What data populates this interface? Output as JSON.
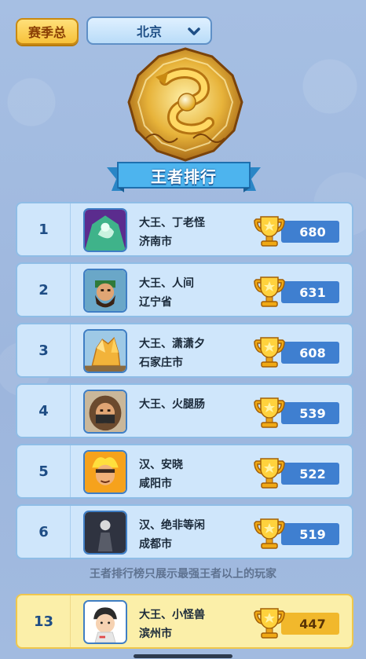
{
  "header": {
    "season_label": "赛季总",
    "city_selected": "北京"
  },
  "banner": {
    "title": "王者排行"
  },
  "ranking": [
    {
      "rank": "1",
      "name": "大王、丁老怪",
      "city": "济南市",
      "score": "680",
      "avatar": "jade-warrior"
    },
    {
      "rank": "2",
      "name": "大王、人间",
      "city": "辽宁省",
      "score": "631",
      "avatar": "bearded-general"
    },
    {
      "rank": "3",
      "name": "大王、潇潇夕",
      "city": "石家庄市",
      "score": "608",
      "avatar": "gold-crystal"
    },
    {
      "rank": "4",
      "name": "大王、火腿肠",
      "city": "",
      "score": "539",
      "avatar": "hooded-traveler"
    },
    {
      "rank": "5",
      "name": "汉、安晓",
      "city": "咸阳市",
      "score": "522",
      "avatar": "flame-boy"
    },
    {
      "rank": "6",
      "name": "汉、绝非等闲",
      "city": "成都市",
      "score": "519",
      "avatar": "dark-figure"
    }
  ],
  "note": "王者排行榜只展示最强王者以上的玩家",
  "my_rank": {
    "rank": "13",
    "name": "大王、小怪兽",
    "city": "滨州市",
    "score": "447",
    "avatar": "cartoon-kid"
  },
  "colors": {
    "row_bg": "#cfe6fb",
    "row_border": "#8fbde6",
    "score_blue": "#3f7fd0",
    "my_row_bg": "#fbefa9",
    "my_score": "#f1b82c",
    "gold": "#f7c23a"
  }
}
